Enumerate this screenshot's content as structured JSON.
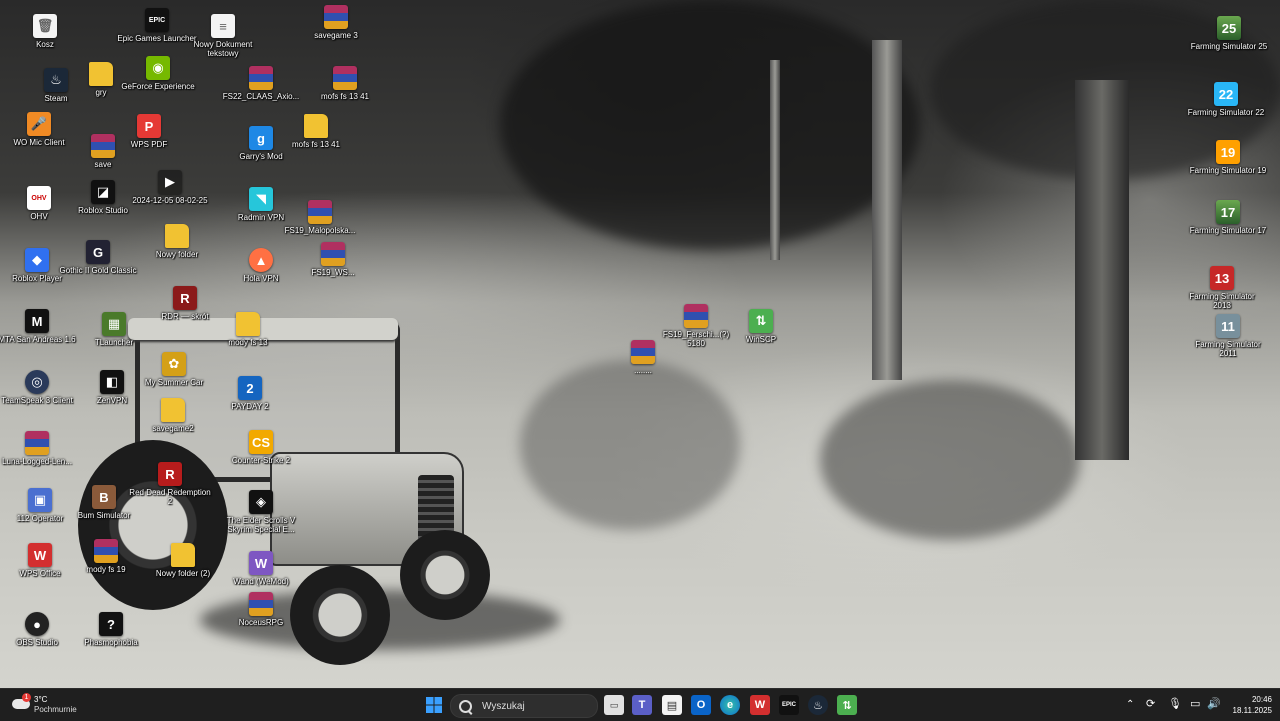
{
  "desktop_icons": {
    "kosz": "Kosz",
    "epic": "Epic Games Launcher",
    "nowy_doc": "Nowy Dokument tekstowy",
    "savegame3": "savegame 3",
    "steam": "Steam",
    "gry": "gry",
    "geforce": "GeForce Experience",
    "fs22_claas": "FS22_CLAAS_Axio...",
    "mofs1341_rar": "mofs fs 13 41",
    "wo_mic": "WO Mic Client",
    "save": "save",
    "wps_pdf": "WPS PDF",
    "garrys": "Garry's Mod",
    "mofs1341_folder": "mofs fs 13 41",
    "ohv": "OHV",
    "roblox_studio": "Roblox Studio",
    "date_file": "2024-12-05 08-02-25",
    "radmin": "Radmin VPN",
    "fs19_malopolska": "FS19_Malopolska...",
    "roblox_player": "Roblox Player",
    "gothic": "Gothic II Gold Classic",
    "nowy_folder_fs": "Nowy folder",
    "hola": "Hola VPN",
    "fs19_ws": "FS19_WS...",
    "rdr": "RDR — skrót",
    "mta": "MTA San Andreas 1.6",
    "tlauncher": "TLauncher",
    "mody_fs13": "mody fs 13",
    "fs19_rar": "FS19_Ferschi...(?) 5180",
    "winscp": "WinSCP",
    "unnamed_rar": "........",
    "my_summer_car": "My Summer Car",
    "teamspeak": "TeamSpeak 3 Client",
    "zenvpn": "ZenVPN",
    "payday2": "PAYDAY 2",
    "savegame2": "savegame2",
    "luna": "Luna-Logged-Len...",
    "counter_strike": "Counter-Strike 2",
    "rdr2": "Red Dead Redemption 2",
    "operator112": "112 Operator",
    "bum_sim": "Bum Simulator",
    "elder_scrolls": "The Elder Scrolls V Skyrim Special E...",
    "wps_office": "WPS Office",
    "mody_fs19": "mody fs 19",
    "nowy_folder2": "Nowy folder (2)",
    "wand": "Wand (WeMod)",
    "obs": "OBS Studio",
    "phasmophobia": "Phasmophobia",
    "noceus": "NoceusRPG",
    "fs25": "Farming Simulator 25",
    "fs22": "Farming Simulator 22",
    "fs19": "Farming Simulator 19",
    "fs17": "Farming Simulator 17",
    "fs2013": "Farming Simulator 2013",
    "fs2011": "Farming Simulator 2011"
  },
  "icon_glyphs": {
    "epic": "EPIC",
    "garrys": "g",
    "wps": "W",
    "ohv": "OHV",
    "fs22": "22",
    "fs19": "19"
  },
  "taskbar": {
    "weather_temp": "3°C",
    "weather_desc": "Pochmurnie",
    "weather_badge": "1",
    "search_placeholder": "Wyszukaj",
    "time": "20:46",
    "date": "18.11.2025",
    "pinned_apps": [
      "file-explorer",
      "teams",
      "microsoft-store",
      "outlook",
      "edge",
      "wps-office",
      "epic-games",
      "steam",
      "file-manager"
    ]
  },
  "colors": {
    "taskbar_bg": "#1f1f1f",
    "windows_blue": "#3aa0ff",
    "wps_red": "#d32f2f"
  }
}
